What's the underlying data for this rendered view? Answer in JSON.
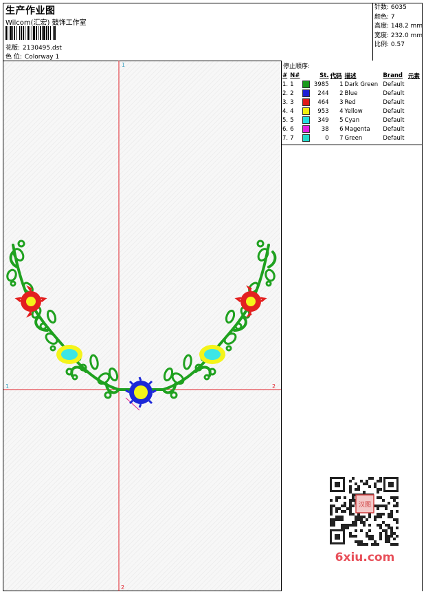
{
  "header": {
    "title": "生产作业图",
    "company": "Wilcom(汇宏) 鼓饰工作室",
    "pattern_label": "花版:",
    "pattern_value": "2130495.dst",
    "colorway_label": "色 位:",
    "colorway_value": "Colorway 1"
  },
  "stats": [
    {
      "label": "针数:",
      "value": "6035"
    },
    {
      "label": "颜色:",
      "value": "7"
    },
    {
      "label": "高度:",
      "value": "148.2 mm"
    },
    {
      "label": "宽度:",
      "value": "232.0 mm"
    },
    {
      "label": "比例:",
      "value": "0.57"
    }
  ],
  "stop_sequence": {
    "title": "停止顺序:",
    "headers": [
      "#",
      "N#",
      "St.",
      "代码",
      "描述",
      "Brand",
      "元素"
    ],
    "rows": [
      {
        "idx": "1.",
        "n": "1",
        "color": "#1a9a1a",
        "stitches": "3985",
        "code": "1",
        "desc": "Dark Green",
        "brand": "Default"
      },
      {
        "idx": "2.",
        "n": "2",
        "color": "#1f1fd6",
        "stitches": "244",
        "code": "2",
        "desc": "Blue",
        "brand": "Default"
      },
      {
        "idx": "3.",
        "n": "3",
        "color": "#e01818",
        "stitches": "464",
        "code": "3",
        "desc": "Red",
        "brand": "Default"
      },
      {
        "idx": "4.",
        "n": "4",
        "color": "#f2f20f",
        "stitches": "953",
        "code": "4",
        "desc": "Yellow",
        "brand": "Default"
      },
      {
        "idx": "5.",
        "n": "5",
        "color": "#22dede",
        "stitches": "349",
        "code": "5",
        "desc": "Cyan",
        "brand": "Default"
      },
      {
        "idx": "6.",
        "n": "6",
        "color": "#e020e0",
        "stitches": "38",
        "code": "6",
        "desc": "Magenta",
        "brand": "Default"
      },
      {
        "idx": "7.",
        "n": "7",
        "color": "#22d8c8",
        "stitches": "0",
        "code": "7",
        "desc": "Green",
        "brand": "Default"
      }
    ]
  },
  "design": {
    "axis_labels": {
      "v_top": "1",
      "v_bottom": "2",
      "h_left": "1",
      "h_right": "2"
    },
    "colors": {
      "leaf": "#1fa11f",
      "red": "#e32020",
      "yellow": "#f4f41a",
      "cyan": "#3ce6e6",
      "blue": "#1c28d8",
      "guide": "#e0202a",
      "magenta": "#e0208a"
    }
  },
  "watermark": {
    "text": "6xiu.com",
    "stamp": "汉图"
  }
}
